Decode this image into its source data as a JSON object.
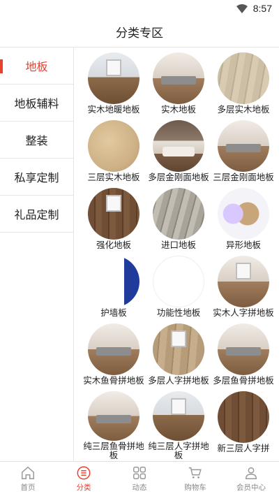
{
  "status": {
    "time": "8:57"
  },
  "header": {
    "title": "分类专区"
  },
  "sidebar": {
    "items": [
      {
        "label": "地板",
        "active": true
      },
      {
        "label": "地板辅料",
        "active": false
      },
      {
        "label": "整装",
        "active": false
      },
      {
        "label": "私享定制",
        "active": false
      },
      {
        "label": "礼品定制",
        "active": false
      }
    ]
  },
  "grid": {
    "items": [
      {
        "label": "实木地暖地板"
      },
      {
        "label": "实木地板"
      },
      {
        "label": "多层实木地板"
      },
      {
        "label": "三层实木地板"
      },
      {
        "label": "多层金刚面地板"
      },
      {
        "label": "三层金刚面地板"
      },
      {
        "label": "强化地板"
      },
      {
        "label": "进口地板"
      },
      {
        "label": "异形地板"
      },
      {
        "label": "护墙板"
      },
      {
        "label": "功能性地板"
      },
      {
        "label": "实木人字拼地板"
      },
      {
        "label": "实木鱼骨拼地板"
      },
      {
        "label": "多层人字拼地板"
      },
      {
        "label": "多层鱼骨拼地板"
      },
      {
        "label": "纯三层鱼骨拼地板"
      },
      {
        "label": "纯三层人字拼地板"
      },
      {
        "label": "新三层人字拼"
      }
    ]
  },
  "tabbar": {
    "tabs": [
      {
        "label": "首页",
        "icon": "home-icon"
      },
      {
        "label": "分类",
        "icon": "category-icon",
        "active": true
      },
      {
        "label": "动态",
        "icon": "grid-icon"
      },
      {
        "label": "购物车",
        "icon": "cart-icon"
      },
      {
        "label": "会员中心",
        "icon": "user-icon"
      }
    ]
  },
  "colors": {
    "accent": "#e8402f",
    "text": "#222222",
    "muted": "#888888",
    "divider": "#e6e6e6"
  }
}
